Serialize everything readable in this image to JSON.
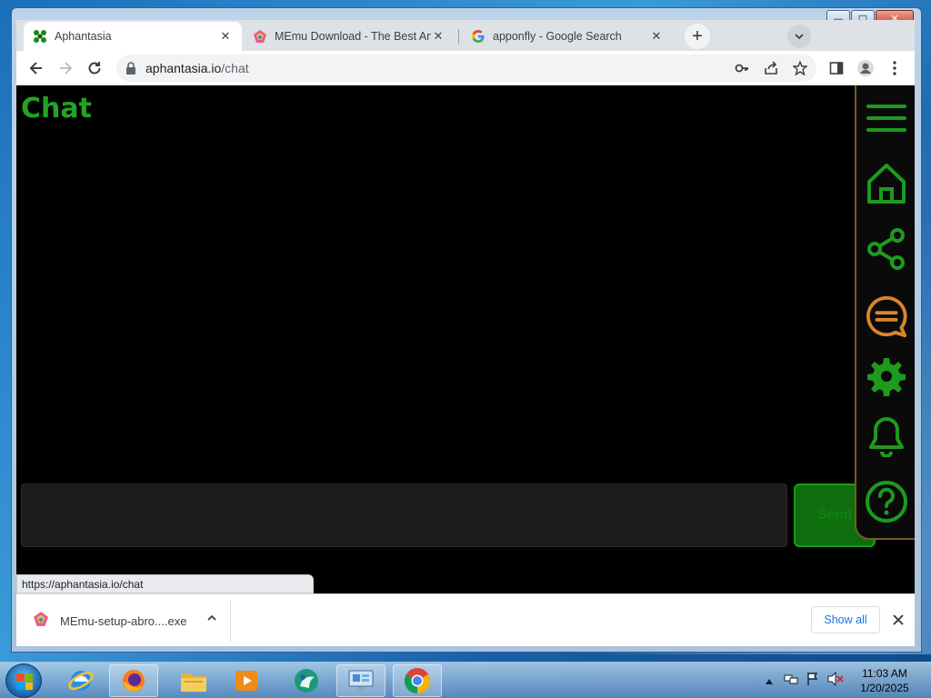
{
  "window": {
    "controls": {
      "minimize": "—",
      "maximize": "□",
      "close": "✕"
    }
  },
  "tabs": [
    {
      "title": "Aphantasia",
      "close": "✕",
      "active": true,
      "favicon": "aphantasia-favicon"
    },
    {
      "title": "MEmu Download - The Best Andr",
      "close": "✕",
      "active": false,
      "favicon": "memu-favicon"
    },
    {
      "title": "apponfly - Google Search",
      "close": "✕",
      "active": false,
      "favicon": "google-favicon"
    }
  ],
  "new_tab_label": "+",
  "tab_menu_label": "⌄",
  "toolbar": {
    "url_host": "aphantasia.io",
    "url_path": "/chat"
  },
  "page": {
    "title": "Chat",
    "input_placeholder": "",
    "send_label": "Send",
    "accent": "#23a323",
    "nav_items": [
      "menu-icon",
      "home-icon",
      "share-icon",
      "chat-icon",
      "settings-icon",
      "bell-icon",
      "help-icon"
    ]
  },
  "status_bar": {
    "url": "https://aphantasia.io/chat"
  },
  "downloads": {
    "file_name": "MEmu-setup-abro....exe",
    "show_all_label": "Show all"
  },
  "taskbar": {
    "time": "11:03 AM",
    "date": "1/20/2025",
    "apps": [
      "internet-explorer-icon",
      "firefox-icon",
      "file-explorer-icon",
      "media-player-icon",
      "app-icon",
      "remote-desktop-icon",
      "chrome-icon"
    ]
  }
}
